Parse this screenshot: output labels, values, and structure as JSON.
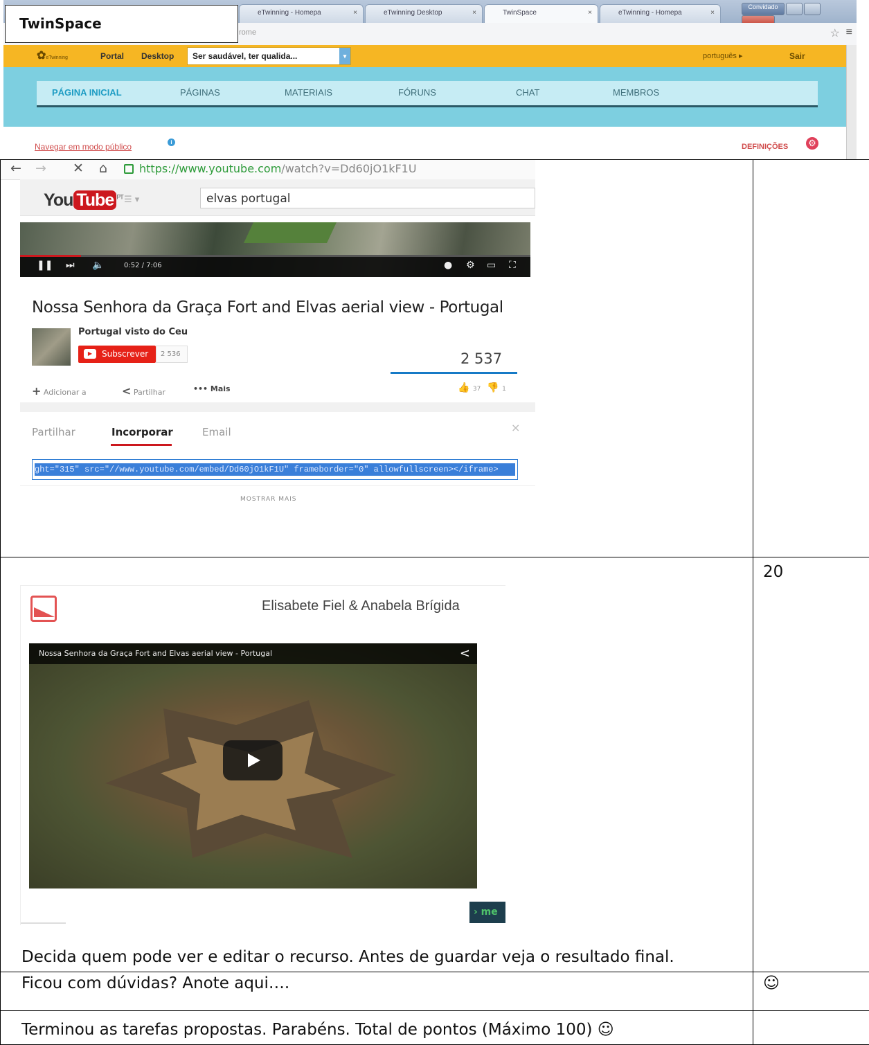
{
  "browser": {
    "tabs": [
      {
        "label": "eTwinning - Homepa",
        "close": "×"
      },
      {
        "label": "eTwinning Desktop",
        "close": "×"
      },
      {
        "label": "TwinSpace",
        "close": "×"
      },
      {
        "label": "eTwinning - Homepa",
        "close": "×"
      }
    ],
    "user_button": "Convidado",
    "address_fragment": "rome"
  },
  "twinspace_label": "TwinSpace",
  "etwinning": {
    "logo": "eTwinning",
    "portal": "Portal",
    "desktop": "Desktop",
    "project_select": "Ser saudável, ter qualida...",
    "language": "português ▸",
    "logout": "Sair",
    "nav": [
      "PÁGINA INICIAL",
      "PÁGINAS",
      "MATERIAIS",
      "FÓRUNS",
      "CHAT",
      "MEMBROS"
    ],
    "public_mode_link": "Navegar em modo público",
    "settings": "DEFINIÇÕES"
  },
  "youtube": {
    "url_host": "https://www.youtube.com",
    "url_path": "/watch?v=Dd60jO1kF1U",
    "logo_you": "You",
    "logo_tube": "Tube",
    "logo_region": "PT",
    "search_query": "elvas portugal",
    "time": "0:52 / 7:06",
    "progress_fraction": 0.12,
    "video_title": "Nossa Senhora da Graça Fort and Elvas aerial view - Portugal",
    "channel": "Portugal visto do Ceu",
    "subscribe_label": "Subscrever",
    "subscriber_count": "2 536",
    "views": "2 537",
    "actions": {
      "add": "Adicionar a",
      "share": "Partilhar",
      "more": "Mais"
    },
    "likes": "37",
    "dislikes": "1",
    "share_tabs": [
      "Partilhar",
      "Incorporar",
      "Email"
    ],
    "embed_code": "ght=\"315\" src=\"//www.youtube.com/embed/Dd60jO1kF1U\" frameborder=\"0\" allowfullscreen></iframe>",
    "show_more": "MOSTRAR MAIS"
  },
  "embed_preview": {
    "authors": "Elisabete Fiel & Anabela Brígida",
    "video_title": "Nossa Senhora da Graça Fort and Elvas aerial view - Portugal",
    "more_button": "me"
  },
  "table": {
    "row2_score": "20",
    "row2_caption": "Decida quem pode ver e editar o recurso. Antes de guardar veja o resultado final.",
    "row3_text": "Ficou com dúvidas? Anote aqui….",
    "row3_score": "☺",
    "row4_text": "Terminou as tarefas propostas. Parabéns. Total de pontos (Máximo 100) ☺",
    "row4_score": ""
  }
}
